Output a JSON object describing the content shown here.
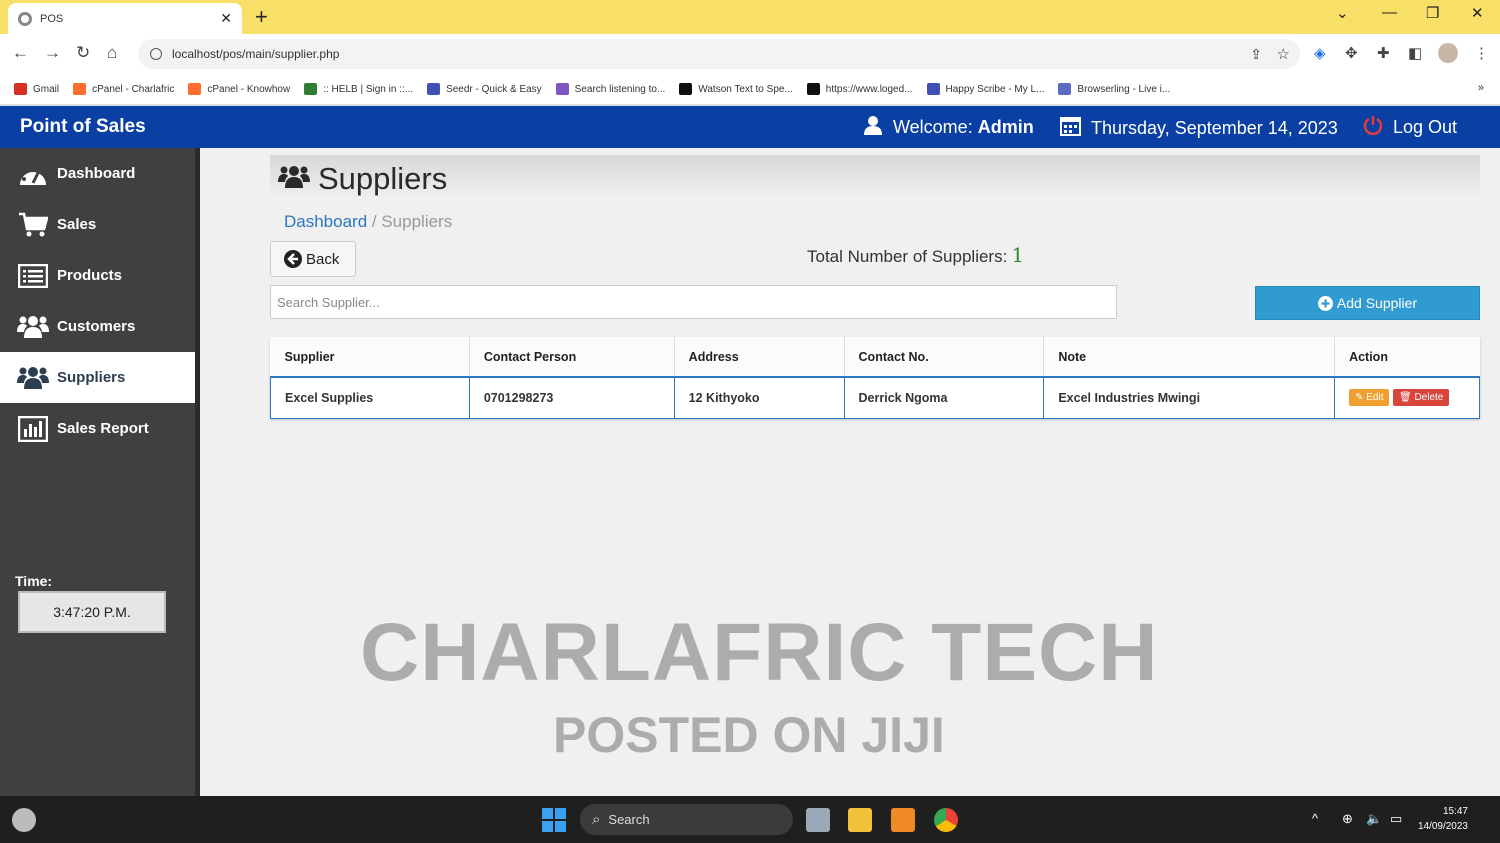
{
  "browser": {
    "tab_title": "POS",
    "url": "localhost/pos/main/supplier.php",
    "bookmarks": [
      {
        "label": "Gmail",
        "color": "#d93025"
      },
      {
        "label": "cPanel - Charlafric",
        "color": "#ff6c2c"
      },
      {
        "label": "cPanel - Knowhow",
        "color": "#ff6c2c"
      },
      {
        "label": ":: HELB | Sign in ::...",
        "color": "#2e7d32"
      },
      {
        "label": "Seedr - Quick & Easy",
        "color": "#3f51b5"
      },
      {
        "label": "Search listening to...",
        "color": "#7e57c2"
      },
      {
        "label": "Watson Text to Spe...",
        "color": "#111111"
      },
      {
        "label": "https://www.loged...",
        "color": "#111111"
      },
      {
        "label": "Happy Scribe - My L...",
        "color": "#3f51b5"
      },
      {
        "label": "Browserling - Live i...",
        "color": "#5c6bc0"
      }
    ],
    "bookmarks_more": "»"
  },
  "header": {
    "brand": "Point of Sales",
    "welcome_prefix": "Welcome:",
    "user": "Admin",
    "date": "Thursday, September 14, 2023",
    "logout": "Log Out",
    "color": "#0a3fa3"
  },
  "sidebar": {
    "items": [
      {
        "label": "Dashboard",
        "icon": "dashboard-icon"
      },
      {
        "label": "Sales",
        "icon": "cart-icon"
      },
      {
        "label": "Products",
        "icon": "list-icon"
      },
      {
        "label": "Customers",
        "icon": "group-icon"
      },
      {
        "label": "Suppliers",
        "icon": "group-icon",
        "active": true
      },
      {
        "label": "Sales Report",
        "icon": "bar-chart-icon"
      }
    ],
    "time_label": "Time:",
    "time_value": "3:47:20 P.M."
  },
  "main": {
    "page_title": "Suppliers",
    "breadcrumb": {
      "home": "Dashboard",
      "separator": " / ",
      "current": "Suppliers"
    },
    "back_label": "Back",
    "total_label": "Total Number of Suppliers:",
    "total_count": "1",
    "search_placeholder": "Search Supplier...",
    "add_label": "Add Supplier",
    "table": {
      "headers": [
        "Supplier",
        "Contact Person",
        "Address",
        "Contact No.",
        "Note",
        "Action"
      ],
      "rows": [
        {
          "supplier": "Excel Supplies",
          "contact_person": "0701298273",
          "address": "12 Kithyoko",
          "contact_no": "Derrick Ngoma",
          "note": "Excel Industries Mwingi"
        }
      ],
      "edit_label": "Edit",
      "delete_label": "Delete"
    },
    "watermark_line1": "CHARLAFRIC TECH",
    "watermark_line2": "POSTED ON JIJI"
  },
  "taskbar": {
    "search_label": "Search",
    "time": "15:47",
    "date": "14/09/2023"
  }
}
